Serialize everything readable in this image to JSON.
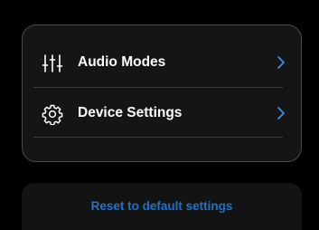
{
  "menu": {
    "items": [
      {
        "label": "Audio Modes",
        "icon": "sliders-icon"
      },
      {
        "label": "Device Settings",
        "icon": "gear-icon"
      }
    ]
  },
  "actions": {
    "reset_label": "Reset to default settings"
  },
  "colors": {
    "background": "#000000",
    "card": "#151515",
    "card_border": "#4a4a4c",
    "accent": "#1f72c9",
    "chevron": "#3a8ee8",
    "text": "#ffffff"
  }
}
